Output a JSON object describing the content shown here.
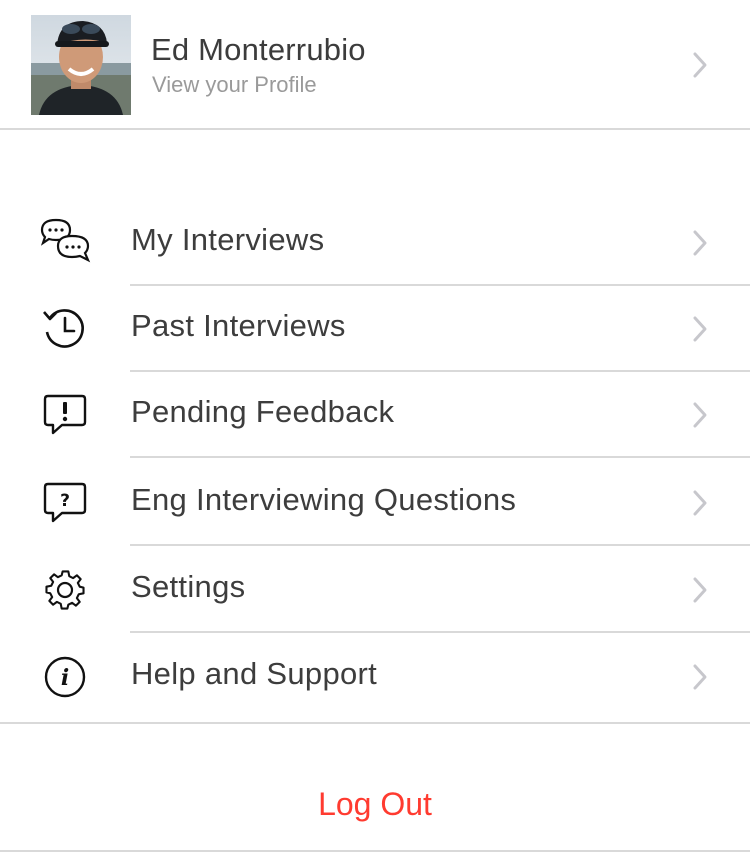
{
  "profile": {
    "name": "Ed Monterrubio",
    "subtitle": "View your Profile",
    "avatar": "user-photo"
  },
  "menu": [
    {
      "label": "My Interviews",
      "icon": "chat-bubbles-icon"
    },
    {
      "label": "Past Interviews",
      "icon": "history-icon"
    },
    {
      "label": "Pending Feedback",
      "icon": "alert-bubble-icon"
    },
    {
      "label": "Eng Interviewing Questions",
      "icon": "question-bubble-icon"
    },
    {
      "label": "Settings",
      "icon": "gear-icon"
    },
    {
      "label": "Help and Support",
      "icon": "info-icon"
    }
  ],
  "logout": {
    "label": "Log Out"
  },
  "colors": {
    "text": "#3d3d3d",
    "subtext": "#9a9a9a",
    "separator": "#d9d9d9",
    "chevron": "#c7c7cc",
    "logout": "#ff3b30"
  }
}
